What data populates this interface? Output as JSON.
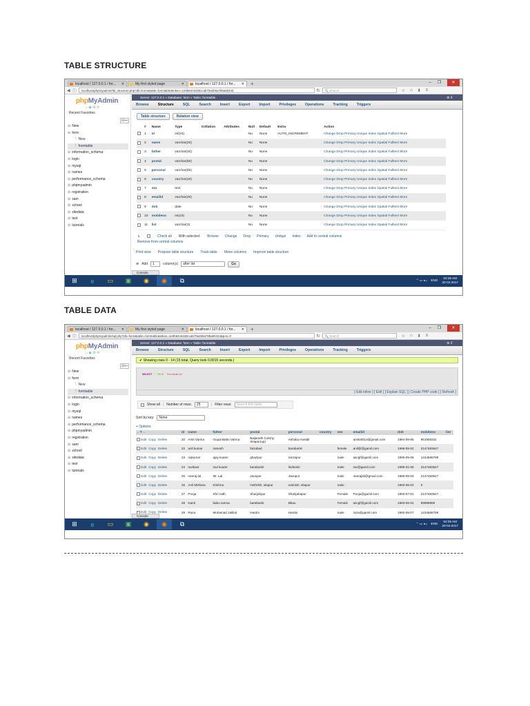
{
  "heading1": "TABLE STRUCTURE",
  "heading2": "TABLE DATA",
  "browser": {
    "tabs": [
      "localhost / 127.0.0.1 / for...",
      "My first styled page",
      "localhost / 127.0.0.1 / for..."
    ],
    "new_tab": "+",
    "url1": "localhost/phpmyadmin/tbl_structure.php?db=form&table=formtable&token=1e0b64c6428ccab70a2b6a785a60434",
    "url2": "localhost/phpmyadmin/sql.php?db=form&table=formtable&token=1e0b64c6428ccab70a2b6a785a60434&pos=0",
    "search_placeholder": "Search"
  },
  "pma": {
    "logo_php": "php",
    "logo_myadmin": "MyAdmin",
    "recent": "Recent",
    "favorites": "Favorites",
    "tree": [
      {
        "label": "New",
        "type": "db"
      },
      {
        "label": "form",
        "type": "db"
      },
      {
        "label": "New",
        "type": "sub"
      },
      {
        "label": "formtable",
        "type": "sub"
      },
      {
        "label": "information_schema",
        "type": "db"
      },
      {
        "label": "login",
        "type": "db"
      },
      {
        "label": "mysql",
        "type": "db"
      },
      {
        "label": "names",
        "type": "db"
      },
      {
        "label": "performance_schema",
        "type": "db"
      },
      {
        "label": "phpmyadmin",
        "type": "db"
      },
      {
        "label": "regstration",
        "type": "db"
      },
      {
        "label": "sam",
        "type": "db"
      },
      {
        "label": "school",
        "type": "db"
      },
      {
        "label": "sitedata",
        "type": "db"
      },
      {
        "label": "test",
        "type": "db"
      },
      {
        "label": "tutorials",
        "type": "db"
      }
    ],
    "breadcrumb": "Server: 127.0.0.1 » Database: form » Table: formtable",
    "menu": [
      "Browse",
      "Structure",
      "SQL",
      "Search",
      "Insert",
      "Export",
      "Import",
      "Privileges",
      "Operations",
      "Tracking",
      "Triggers"
    ],
    "console": "Console"
  },
  "structure": {
    "subtabs": [
      "Table structure",
      "Relation view"
    ],
    "headers": [
      "#",
      "Name",
      "Type",
      "Collation",
      "Attributes",
      "Null",
      "Default",
      "Extra",
      "Action"
    ],
    "rows": [
      {
        "n": "1",
        "name": "id",
        "type": "int(10)",
        "null": "No",
        "def": "None",
        "extra": "AUTO_INCREMENT"
      },
      {
        "n": "2",
        "name": "name",
        "type": "varchar(20)",
        "null": "No",
        "def": "None",
        "extra": ""
      },
      {
        "n": "3",
        "name": "father",
        "type": "varchar(20)",
        "null": "No",
        "def": "None",
        "extra": ""
      },
      {
        "n": "4",
        "name": "postal",
        "type": "varchar(50)",
        "null": "No",
        "def": "None",
        "extra": ""
      },
      {
        "n": "5",
        "name": "personal",
        "type": "varchar(50)",
        "null": "No",
        "def": "None",
        "extra": ""
      },
      {
        "n": "6",
        "name": "country",
        "type": "varchar(20)",
        "null": "No",
        "def": "None",
        "extra": ""
      },
      {
        "n": "7",
        "name": "sex",
        "type": "text",
        "null": "No",
        "def": "None",
        "extra": ""
      },
      {
        "n": "8",
        "name": "emailid",
        "type": "varchar(20)",
        "null": "No",
        "def": "None",
        "extra": ""
      },
      {
        "n": "9",
        "name": "dob",
        "type": "date",
        "null": "No",
        "def": "None",
        "extra": ""
      },
      {
        "n": "10",
        "name": "mobileno",
        "type": "int(10)",
        "null": "No",
        "def": "None",
        "extra": ""
      },
      {
        "n": "11",
        "name": "list",
        "type": "varchar(3)",
        "null": "No",
        "def": "None",
        "extra": ""
      }
    ],
    "actions": "Change  Drop  Primary  Unique  Index  Spatial  Fulltext  More",
    "check_all": "Check all",
    "with_selected": "With selected:",
    "bulk": [
      "Browse",
      "Change",
      "Drop",
      "Primary",
      "Unique",
      "Index",
      "Add to central columns"
    ],
    "remove_central": "Remove from central columns",
    "links": [
      "Print view",
      "Propose table structure",
      "Track table",
      "Move columns",
      "Improve table structure"
    ],
    "add_label": "Add",
    "add_count": "1",
    "column_s": "column(s)",
    "after": "after list",
    "go": "Go"
  },
  "data": {
    "success": "Showing rows 0 - 14 (15 total, Query took 0.0015 seconds.)",
    "sql_select": "SELECT",
    "sql_star": "* FROM",
    "sql_table": "`formtable`",
    "sql_links": "[ Edit inline ] [ Edit ] [ Explain SQL ] [ Create PHP code ] [ Refresh ]",
    "show_all": "Show all",
    "num_rows_label": "Number of rows:",
    "num_rows": "25",
    "filter_label": "Filter rows:",
    "filter_placeholder": "Search this table",
    "sort_label": "Sort by key:",
    "sort_value": "None",
    "options": "+ Options",
    "headers": [
      "id",
      "name",
      "father",
      "postal",
      "personal",
      "country",
      "sex",
      "emailid",
      "dob",
      "mobileno",
      "list"
    ],
    "row_actions": [
      "Edit",
      "Copy",
      "Delete"
    ],
    "rows": [
      [
        "20",
        "Amit Varma",
        "Gopal Babu Varma",
        "Baijanath Colony, Sitapur(up)",
        "Ashoka Hostall",
        "",
        "",
        "amitv6014@gmail.com",
        "1994-06-05",
        "961906331",
        ""
      ],
      [
        "22",
        "anil kumar",
        "ramesh",
        "faizabad",
        "barabanki",
        "",
        "female",
        "anil@@gamil.com",
        "1996-05-02",
        "2147483647",
        ""
      ],
      [
        "23",
        "rajkumar",
        "ajay kuamr",
        "ghazipur",
        "mirzapur",
        "",
        "male",
        "ascgf@gamil.com",
        "1996-05-08",
        "1234566789",
        ""
      ],
      [
        "24",
        "ravikant",
        "ravi kuamr",
        "barabanki",
        "lindtonki",
        "",
        "male",
        "rav@gamil.com",
        "1996-01-08",
        "2147483647",
        ""
      ],
      [
        "25",
        "neeraj lal",
        "Mr. Lal",
        "Jaunpur",
        "Jaunpur",
        "",
        "male",
        "neerajlal@gmail.com",
        "1996-05-03",
        "2147483647",
        ""
      ],
      [
        "26",
        "Anil Mishara",
        "Krishna",
        "mishrikh, sitapur",
        "naimish, sitapur",
        "",
        "male",
        "",
        "1993-06-04",
        "0",
        ""
      ],
      [
        "27",
        "Pooja",
        "Shri nath",
        "Sharjahpur",
        "Shahjahapur",
        "",
        "Female",
        "Pooja@gamil.com",
        "1993-07-01",
        "2147483647",
        ""
      ],
      [
        "28",
        "Kanti",
        "babu varma",
        "barabanki",
        "Bbau",
        "",
        "Female",
        "ascgf@gamil.com",
        "1993-06-04",
        "99999999",
        ""
      ],
      [
        "29",
        "Raza",
        "Mohamad Jalibul",
        "Hardoi",
        "Hardoi",
        "",
        "male",
        "raza@gamil.com",
        "1992-05-07",
        "1234566789",
        ""
      ]
    ]
  },
  "taskbar": {
    "time": "02:35 AM",
    "date": "20-02-2017",
    "lang": "ENG"
  }
}
